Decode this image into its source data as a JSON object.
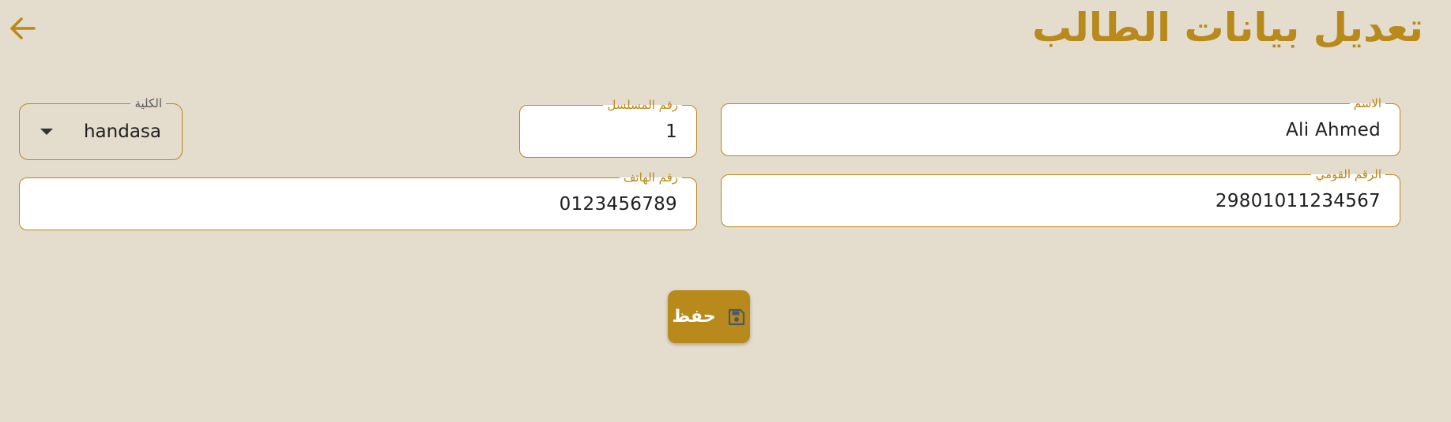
{
  "header": {
    "title": "تعديل بيانات الطالب",
    "back_icon": "arrow-left-icon"
  },
  "form": {
    "name": {
      "label": "الاسم",
      "value": "Ali Ahmed"
    },
    "serial": {
      "label": "رقم المسلسل",
      "value": "1"
    },
    "faculty": {
      "label": "الكلية",
      "value": "handasa",
      "icon": "caret-down-icon"
    },
    "national_id": {
      "label": "الرقم القومي",
      "value": "29801011234567"
    },
    "phone": {
      "label": "رقم الهاتف",
      "value": "0123456789"
    }
  },
  "actions": {
    "save_label": "حفظ",
    "save_icon": "floppy-disk-icon"
  },
  "colors": {
    "background": "#e4dccd",
    "accent": "#b8891b",
    "field_bg": "#ffffff",
    "save_icon": "#4a5a6a"
  }
}
